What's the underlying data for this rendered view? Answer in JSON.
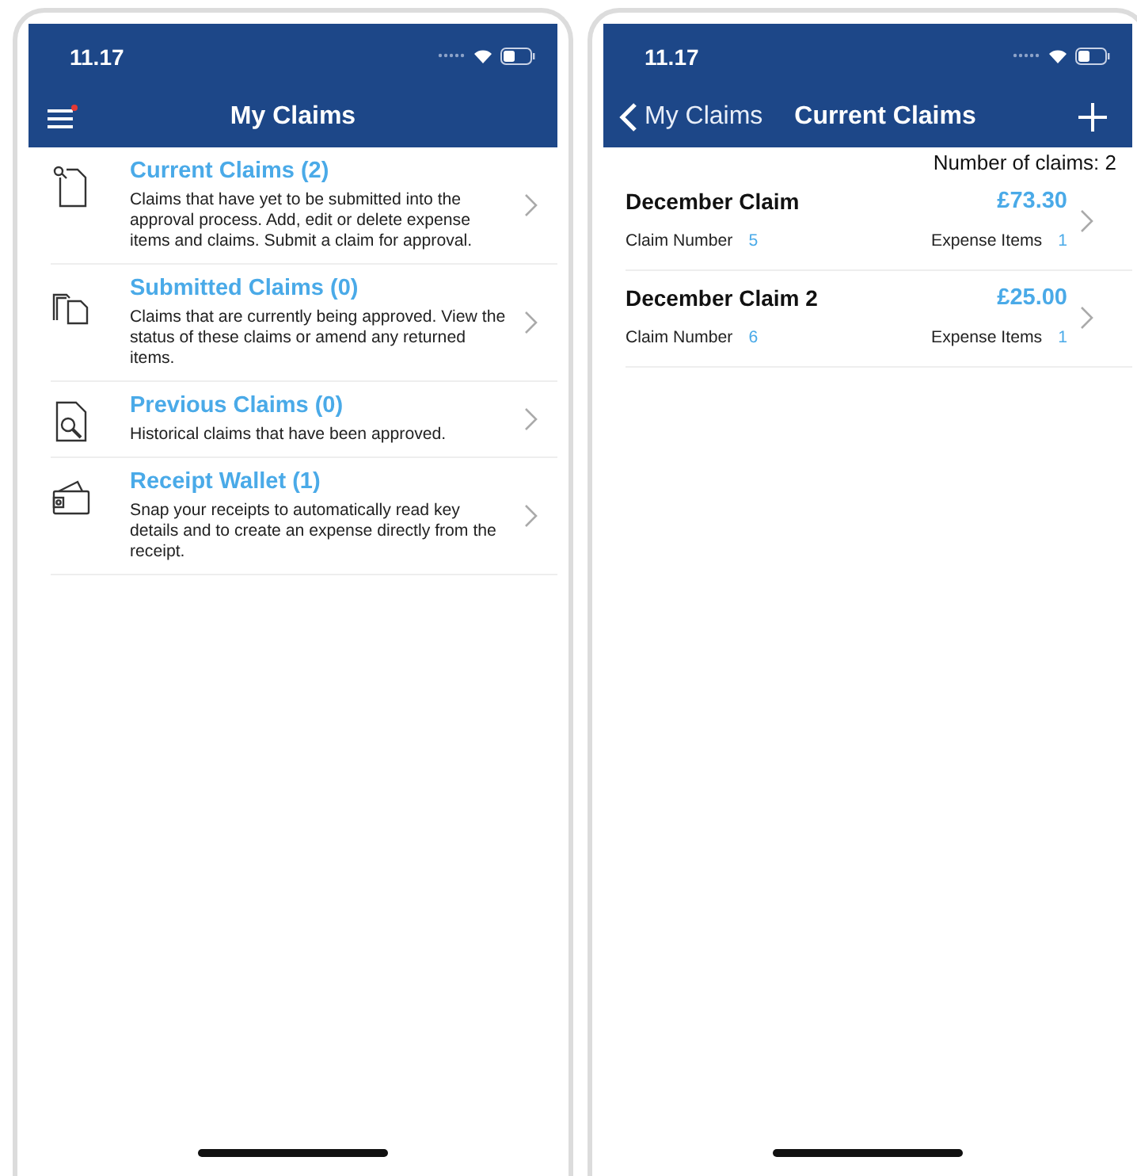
{
  "screens": [
    {
      "kind": "menu",
      "status_bar": {
        "time": "11.17"
      },
      "nav": {
        "title": "My Claims",
        "menu_badge": true
      },
      "items": [
        {
          "kind": "document",
          "title": "Current Claims (2)",
          "description": "Claims that have yet to be submitted into the approval process. Add, edit or delete expense items and claims. Submit a claim for approval."
        },
        {
          "kind": "documents",
          "title": "Submitted Claims (0)",
          "description": "Claims that are currently being approved. View the status of these claims or amend any returned items."
        },
        {
          "kind": "search-document",
          "title": "Previous Claims (0)",
          "description": "Historical claims that have been approved."
        },
        {
          "kind": "wallet",
          "title": "Receipt Wallet (1)",
          "description": "Snap your receipts to automatically read key details and to create an expense directly from the receipt."
        }
      ]
    },
    {
      "kind": "list",
      "status_bar": {
        "time": "11.17"
      },
      "nav": {
        "back": "My Claims",
        "title": "Current Claims"
      },
      "count": "Number of claims: 2",
      "claims": [
        {
          "name": "December Claim",
          "amount": "£73.30",
          "number_label": "Claim Number",
          "number": "5",
          "items_label": "Expense Items",
          "items": "1"
        },
        {
          "name": "December Claim 2",
          "amount": "£25.00",
          "number_label": "Claim Number",
          "number": "6",
          "items_label": "Expense Items",
          "items": "1"
        }
      ]
    }
  ]
}
